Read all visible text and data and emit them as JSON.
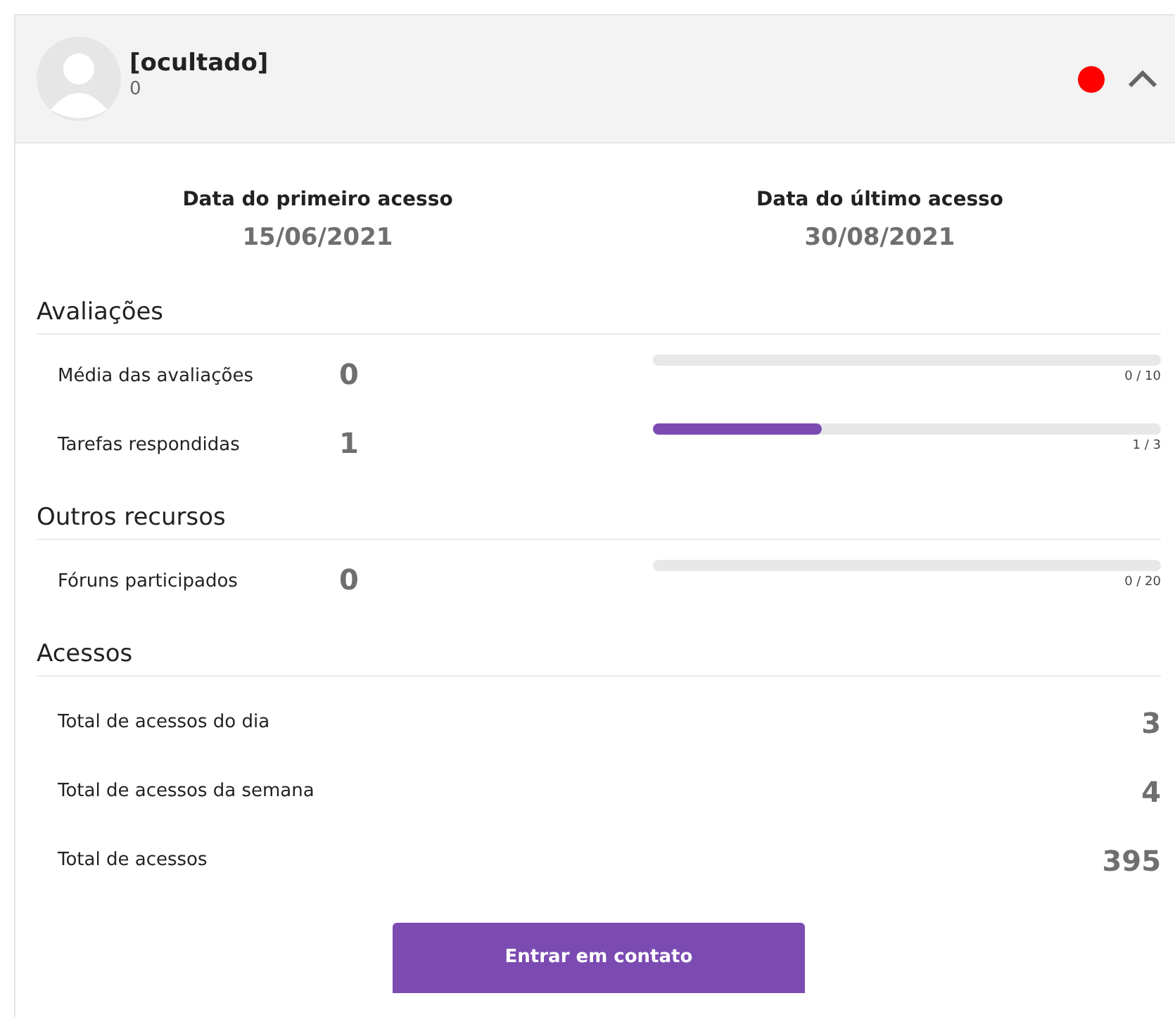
{
  "header": {
    "name": "[ocultado]",
    "subtitle": "0",
    "online": false,
    "expanded": true
  },
  "dates": [
    {
      "label": "Data do primeiro acesso",
      "value": "15/06/2021"
    },
    {
      "label": "Data do último acesso",
      "value": "30/08/2021"
    }
  ],
  "sections": [
    {
      "title": "Avaliações",
      "rows": [
        {
          "kind": "meter",
          "label": "Média das avaliações",
          "value": "0",
          "level": 0,
          "reading": "0 / 10"
        },
        {
          "kind": "meter",
          "label": "Tarefas respondidas",
          "value": "1",
          "level": 0.333,
          "reading": "1 / 3"
        }
      ]
    },
    {
      "title": "Outros recursos",
      "rows": [
        {
          "kind": "meter",
          "label": "Fóruns participados",
          "value": "0",
          "level": 0,
          "reading": "0 / 20"
        }
      ]
    },
    {
      "title": "Acessos",
      "rows": [
        {
          "kind": "count",
          "label": "Total de acessos do dia",
          "value": "3"
        },
        {
          "kind": "count",
          "label": "Total de acessos da semana",
          "value": "4"
        },
        {
          "kind": "count",
          "label": "Total de acessos",
          "value": "395"
        }
      ]
    }
  ],
  "button": {
    "label": "Entrar em contato"
  }
}
